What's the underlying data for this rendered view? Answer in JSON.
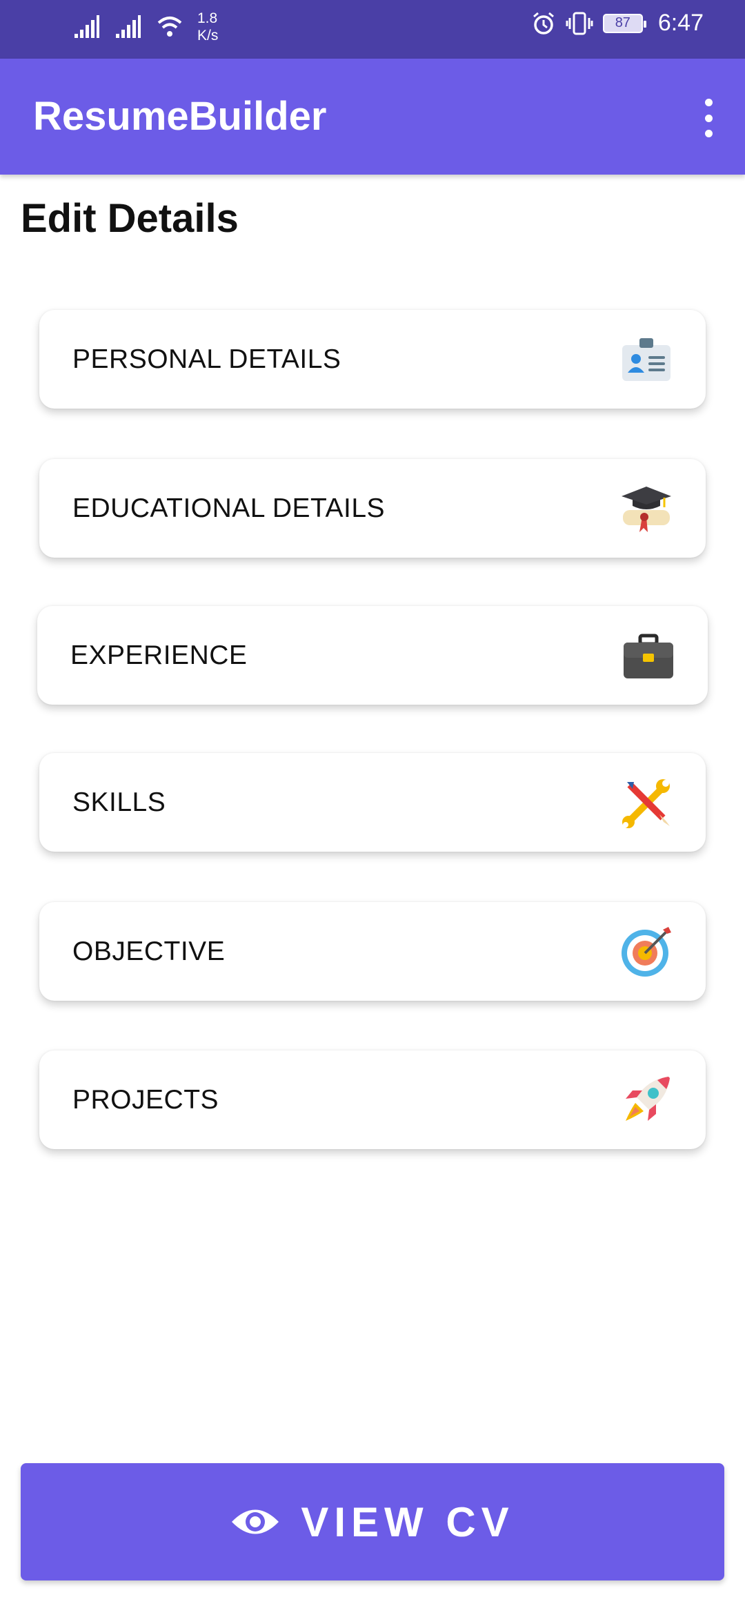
{
  "status_bar": {
    "net_speed_value": "1.8",
    "net_speed_unit": "K/s",
    "battery": "87",
    "time": "6:47"
  },
  "app_bar": {
    "title": "ResumeBuilder"
  },
  "page": {
    "title": "Edit Details"
  },
  "sections": [
    {
      "label": "PERSONAL DETAILS",
      "icon": "id-card-icon"
    },
    {
      "label": "EDUCATIONAL DETAILS",
      "icon": "graduation-cap-icon"
    },
    {
      "label": "EXPERIENCE",
      "icon": "briefcase-icon"
    },
    {
      "label": "SKILLS",
      "icon": "tools-icon"
    },
    {
      "label": "OBJECTIVE",
      "icon": "target-icon"
    },
    {
      "label": "PROJECTS",
      "icon": "rocket-icon"
    }
  ],
  "action": {
    "label": "VIEW CV",
    "icon": "eye-icon"
  },
  "colors": {
    "status_bar": "#4a3fa6",
    "primary": "#6c5ce7",
    "text": "#111111"
  }
}
